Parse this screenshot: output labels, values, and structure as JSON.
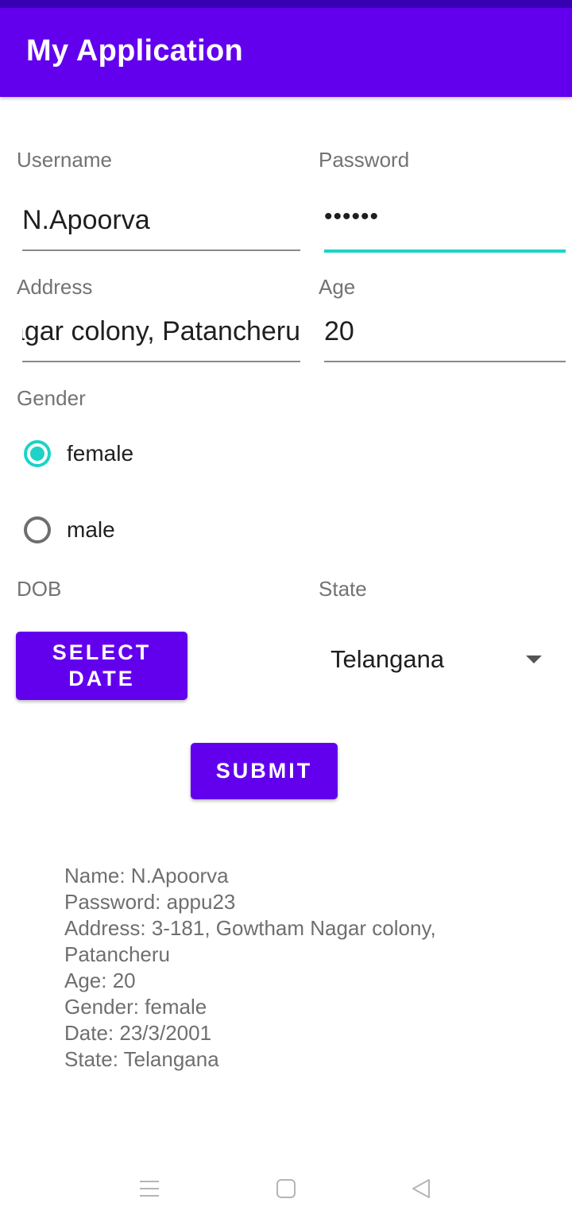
{
  "app": {
    "title": "My Application"
  },
  "form": {
    "username": {
      "label": "Username",
      "value": "N.Apoorva"
    },
    "password": {
      "label": "Password",
      "value": "••••••"
    },
    "address": {
      "label": "Address",
      "value": "3-181, Gowtham Nagar colony, Patancheru"
    },
    "age": {
      "label": "Age",
      "value": "20"
    },
    "gender": {
      "label": "Gender",
      "options": [
        {
          "label": "female",
          "checked": true
        },
        {
          "label": "male",
          "checked": false
        }
      ]
    },
    "dob": {
      "label": "DOB",
      "button_label": "SELECT DATE"
    },
    "state": {
      "label": "State",
      "selected": "Telangana"
    },
    "submit_label": "SUBMIT"
  },
  "summary": {
    "lines": [
      "Name: N.Apoorva",
      "Password: appu23",
      "Address: 3-181, Gowtham Nagar colony,",
      "Patancheru",
      "Age: 20",
      "Gender: female",
      "Date: 23/3/2001",
      "State: Telangana"
    ]
  },
  "nav": {
    "icons": [
      "menu-icon",
      "home-square-icon",
      "back-triangle-icon"
    ]
  },
  "colors": {
    "primary": "#6200ee",
    "primary_dark": "#3700b3",
    "accent": "#1dd3c8"
  }
}
